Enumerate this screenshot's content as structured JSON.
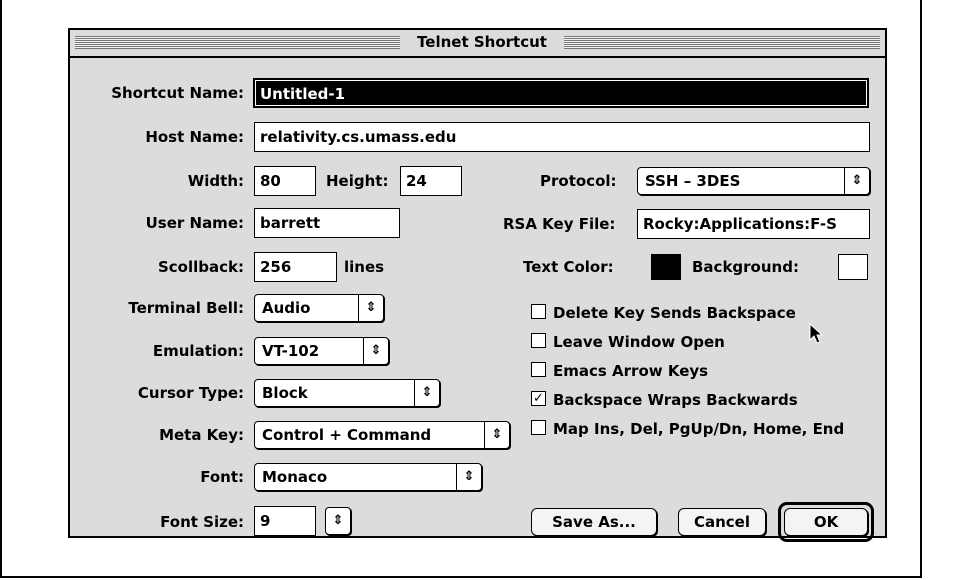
{
  "window": {
    "title": "Telnet Shortcut"
  },
  "labels": {
    "shortcut_name": "Shortcut Name:",
    "host_name": "Host Name:",
    "width": "Width:",
    "height": "Height:",
    "user_name": "User Name:",
    "scrollback": "Scollback:",
    "lines": "lines",
    "terminal_bell": "Terminal Bell:",
    "emulation": "Emulation:",
    "cursor_type": "Cursor Type:",
    "meta_key": "Meta Key:",
    "font": "Font:",
    "font_size": "Font Size:",
    "protocol": "Protocol:",
    "rsa_key_file": "RSA Key File:",
    "text_color": "Text Color:",
    "background": "Background:"
  },
  "fields": {
    "shortcut_name": "Untitled-1",
    "host_name": "relativity.cs.umass.edu",
    "width": "80",
    "height": "24",
    "user_name": "barrett",
    "scrollback": "256",
    "rsa_key_file": "Rocky:Applications:F-S",
    "font_size": "9"
  },
  "popups": {
    "terminal_bell": "Audio",
    "emulation": "VT-102",
    "cursor_type": "Block",
    "meta_key": "Control + Command",
    "font": "Monaco",
    "protocol": "SSH – 3DES",
    "arrow_glyph": "⇕"
  },
  "colors": {
    "text_color": "#000000",
    "background": "#ffffff"
  },
  "checkboxes": [
    {
      "label": "Delete Key Sends Backspace",
      "checked": false,
      "mark": ""
    },
    {
      "label": "Leave Window Open",
      "checked": false,
      "mark": ""
    },
    {
      "label": "Emacs Arrow Keys",
      "checked": false,
      "mark": ""
    },
    {
      "label": "Backspace Wraps Backwards",
      "checked": true,
      "mark": "✓"
    },
    {
      "label": "Map Ins, Del, PgUp/Dn, Home, End",
      "checked": false,
      "mark": ""
    }
  ],
  "buttons": {
    "save_as": "Save As...",
    "cancel": "Cancel",
    "ok": "OK"
  }
}
